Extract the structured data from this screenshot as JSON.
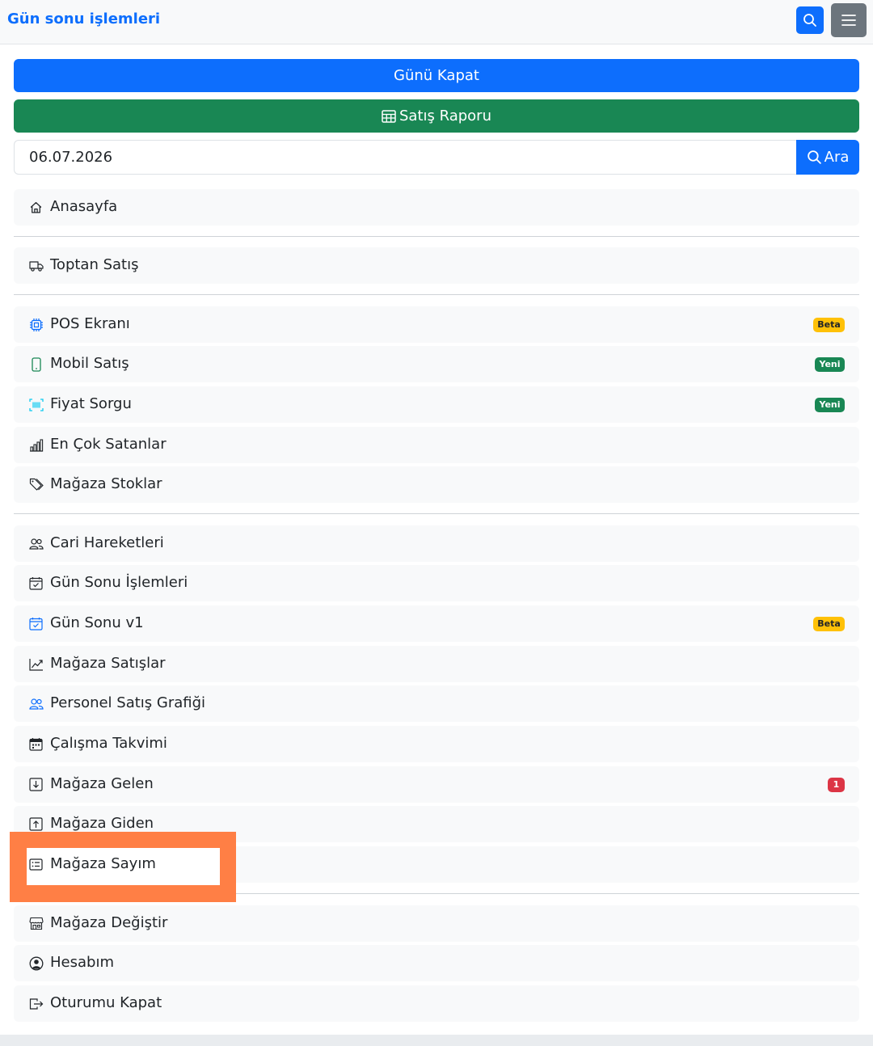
{
  "header": {
    "title": "Gün sonu işlemleri",
    "search_icon": "search-icon",
    "menu_icon": "hamburger-menu-icon"
  },
  "actions": {
    "close_day_label": "Günü Kapat",
    "sales_report_label": "Satış Raporu",
    "sales_report_icon": "table-icon"
  },
  "date_search": {
    "date_value": "06.07.2026",
    "search_label": "Ara"
  },
  "menu": {
    "home": {
      "label": "Anasayfa",
      "icon": "home-icon"
    },
    "wholesale": {
      "label": "Toptan Satış",
      "icon": "truck-icon"
    },
    "pos": {
      "label": "POS Ekranı",
      "icon": "cpu-icon",
      "badge": "Beta"
    },
    "mobile_sales": {
      "label": "Mobil Satış",
      "icon": "phone-icon",
      "badge": "Yeni"
    },
    "price_query": {
      "label": "Fiyat Sorgu",
      "icon": "barcode-scan-icon",
      "badge": "Yeni"
    },
    "best_sellers": {
      "label": "En Çok Satanlar",
      "icon": "bar-chart-icon"
    },
    "store_stocks": {
      "label": "Mağaza Stoklar",
      "icon": "tags-icon"
    },
    "account_moves": {
      "label": "Cari Hareketleri",
      "icon": "people-icon"
    },
    "end_of_day": {
      "label": "Gün Sonu İşlemleri",
      "icon": "calendar-check-icon"
    },
    "end_of_day_v1": {
      "label": "Gün Sonu v1",
      "icon": "calendar-check-icon",
      "badge": "Beta"
    },
    "store_sales": {
      "label": "Mağaza Satışlar",
      "icon": "graph-up-icon"
    },
    "staff_sales_chart": {
      "label": "Personel Satış Grafiği",
      "icon": "people-icon"
    },
    "work_calendar": {
      "label": "Çalışma Takvimi",
      "icon": "calendar-week-icon"
    },
    "store_incoming": {
      "label": "Mağaza Gelen",
      "icon": "box-arrow-in-down-icon",
      "badge": "1"
    },
    "store_outgoing": {
      "label": "Mağaza Giden",
      "icon": "box-arrow-up-icon"
    },
    "store_count": {
      "label": "Mağaza Sayım",
      "icon": "card-list-icon"
    },
    "change_store": {
      "label": "Mağaza Değiştir",
      "icon": "shop-icon"
    },
    "my_account": {
      "label": "Hesabım",
      "icon": "person-circle-icon"
    },
    "logout": {
      "label": "Oturumu Kapat",
      "icon": "box-arrow-right-icon"
    }
  },
  "colors": {
    "primary": "#0d6efd",
    "success": "#198754",
    "warning": "#ffc107",
    "danger": "#dc3545",
    "highlight": "#ff7f45"
  }
}
